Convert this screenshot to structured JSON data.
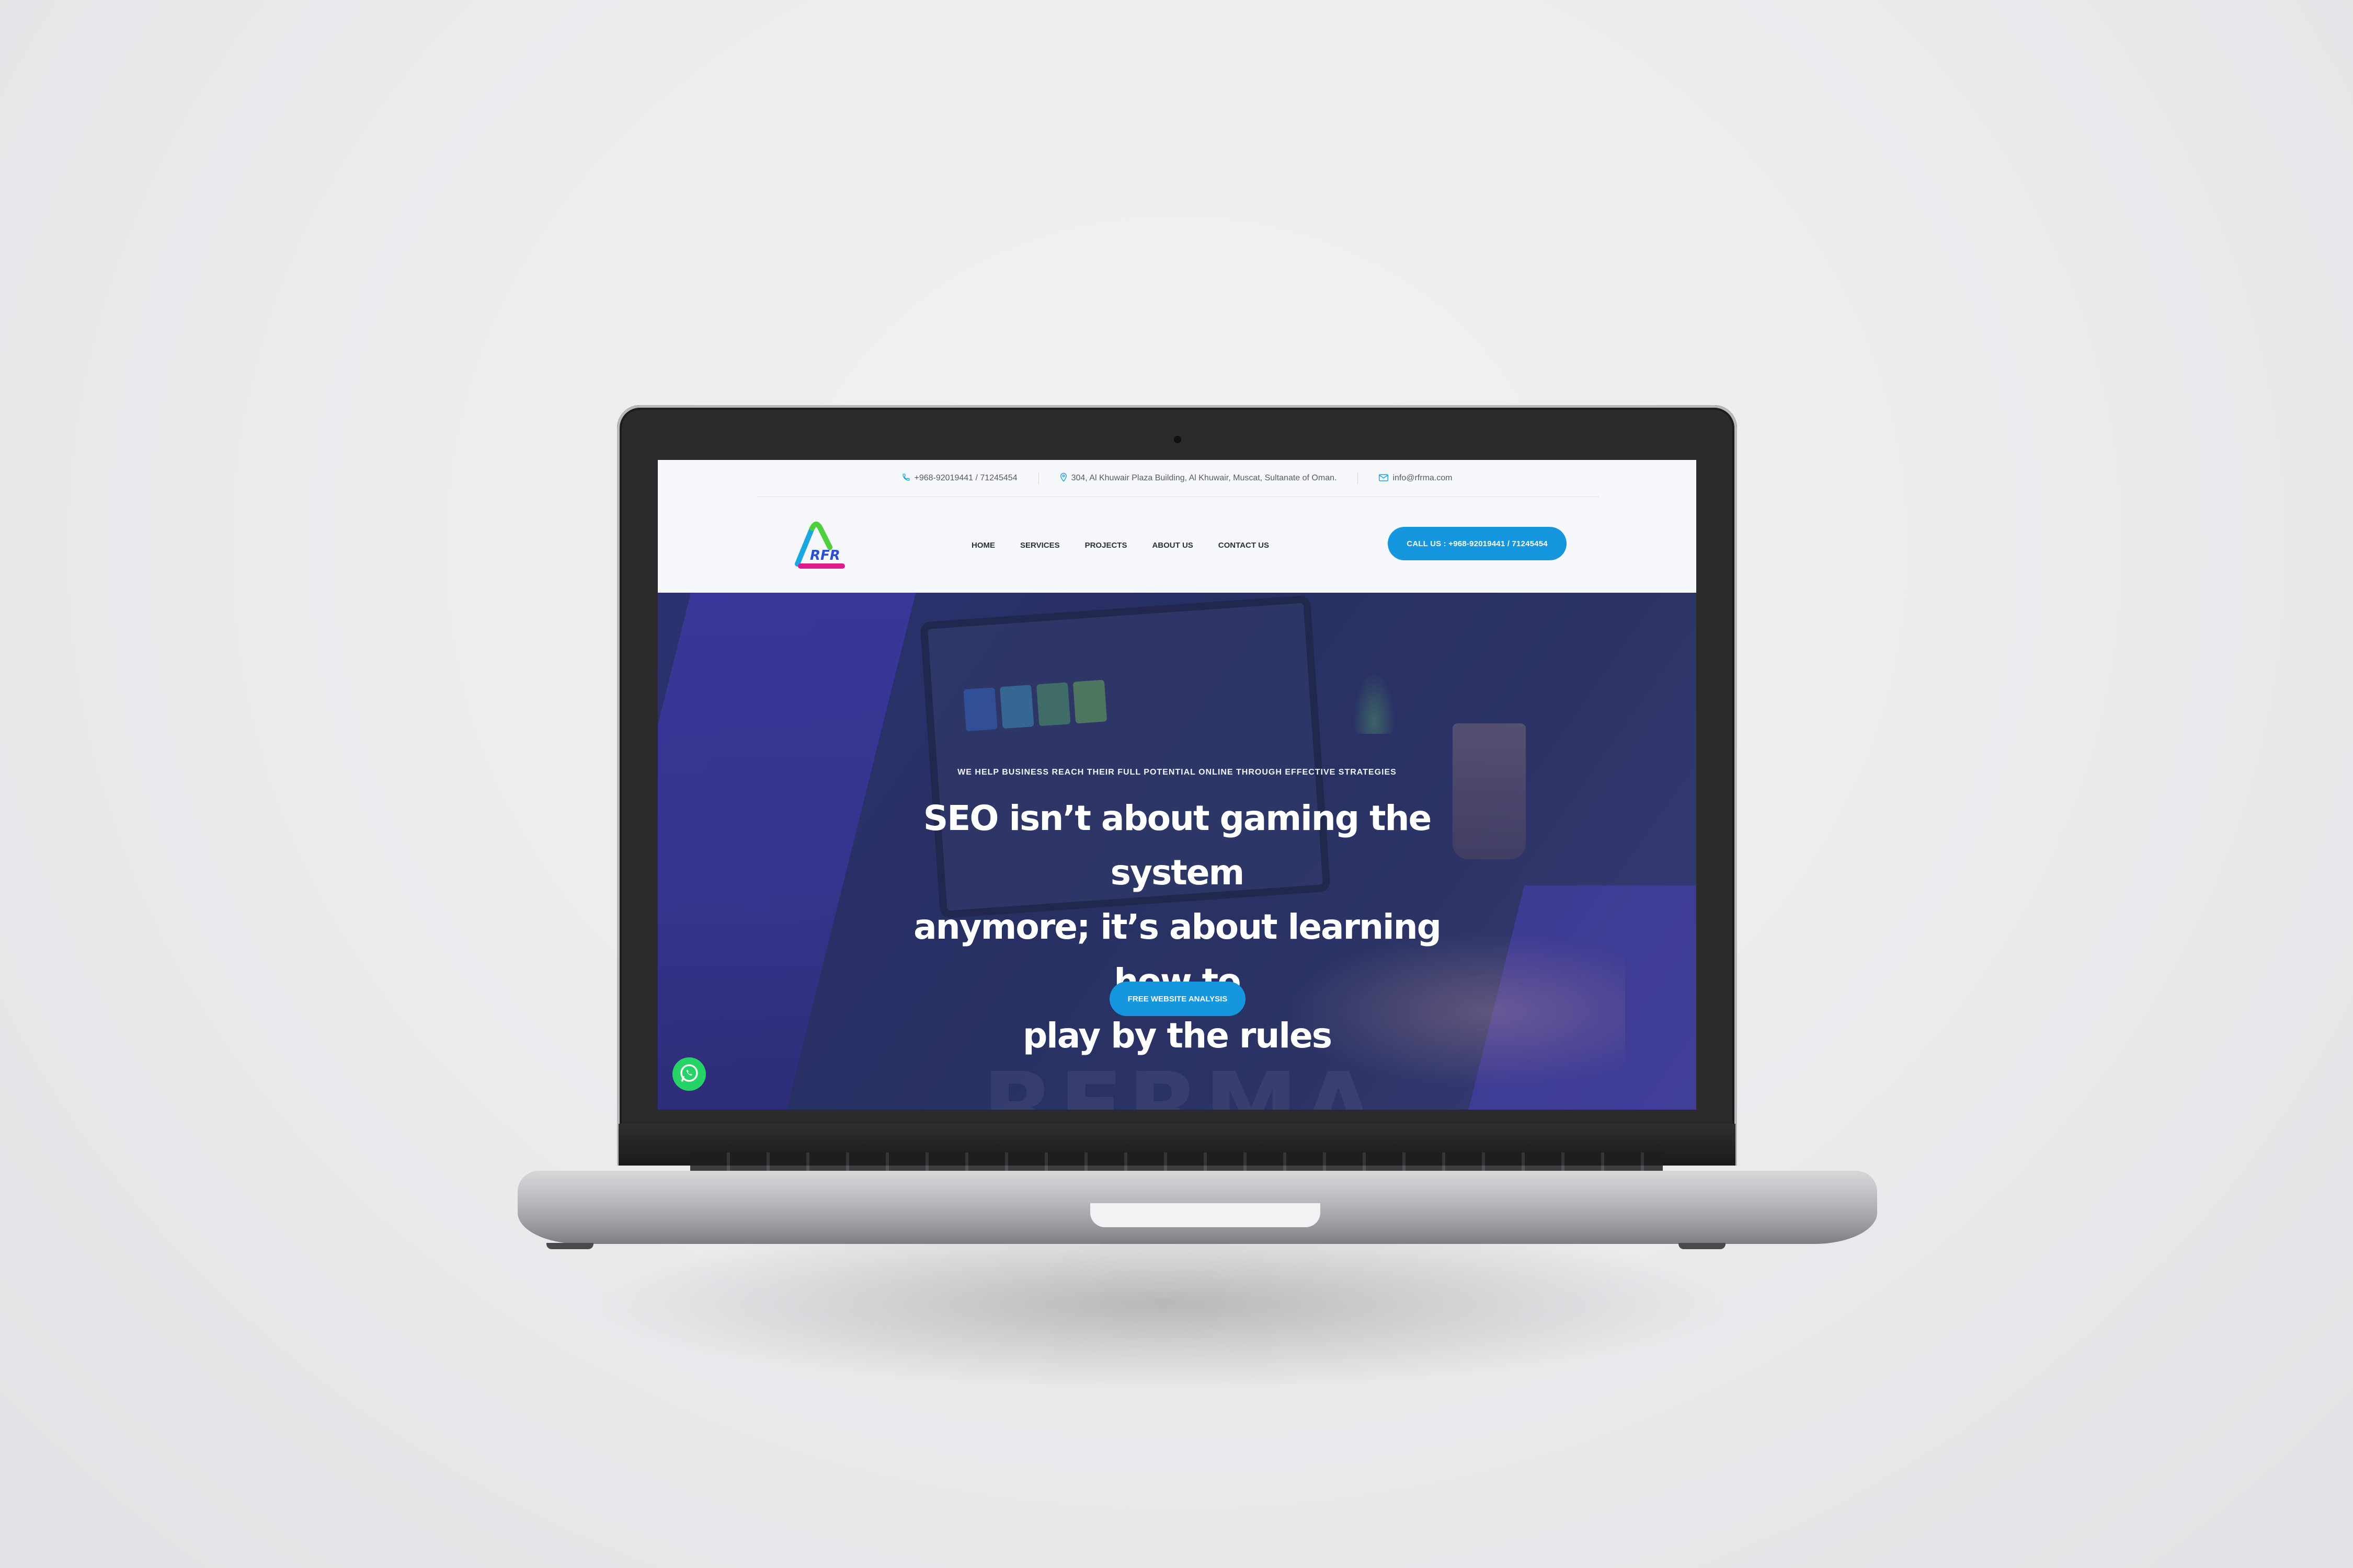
{
  "topbar": {
    "phone": "+968-92019441 / 71245454",
    "address": "304, Al Khuwair Plaza Building, Al Khuwair, Muscat, Sultanate of Oman.",
    "email": "info@rfrma.com"
  },
  "logo": {
    "text": "RFR"
  },
  "nav": {
    "items": [
      {
        "label": "HOME"
      },
      {
        "label": "SERVICES"
      },
      {
        "label": "PROJECTS"
      },
      {
        "label": "ABOUT US"
      },
      {
        "label": "CONTACT US"
      }
    ]
  },
  "cta": {
    "label": "CALL US : +968-92019441 / 71245454"
  },
  "hero": {
    "eyebrow": "WE HELP BUSINESS REACH THEIR FULL POTENTIAL ONLINE THROUGH EFFECTIVE STRATEGIES",
    "headline_1": "SEO isn’t about gaming the system",
    "headline_2": "anymore; it’s about learning how to",
    "headline_3": "play by the rules",
    "button": "FREE WEBSITE ANALYSIS",
    "watermark": "RFRMA"
  },
  "icons": {
    "phone": "phone-icon",
    "location": "map-pin-icon",
    "email": "mail-icon",
    "whatsapp": "whatsapp-icon"
  },
  "colors": {
    "accent": "#1596de",
    "hero_bg": "#273063",
    "whatsapp": "#25d366"
  }
}
